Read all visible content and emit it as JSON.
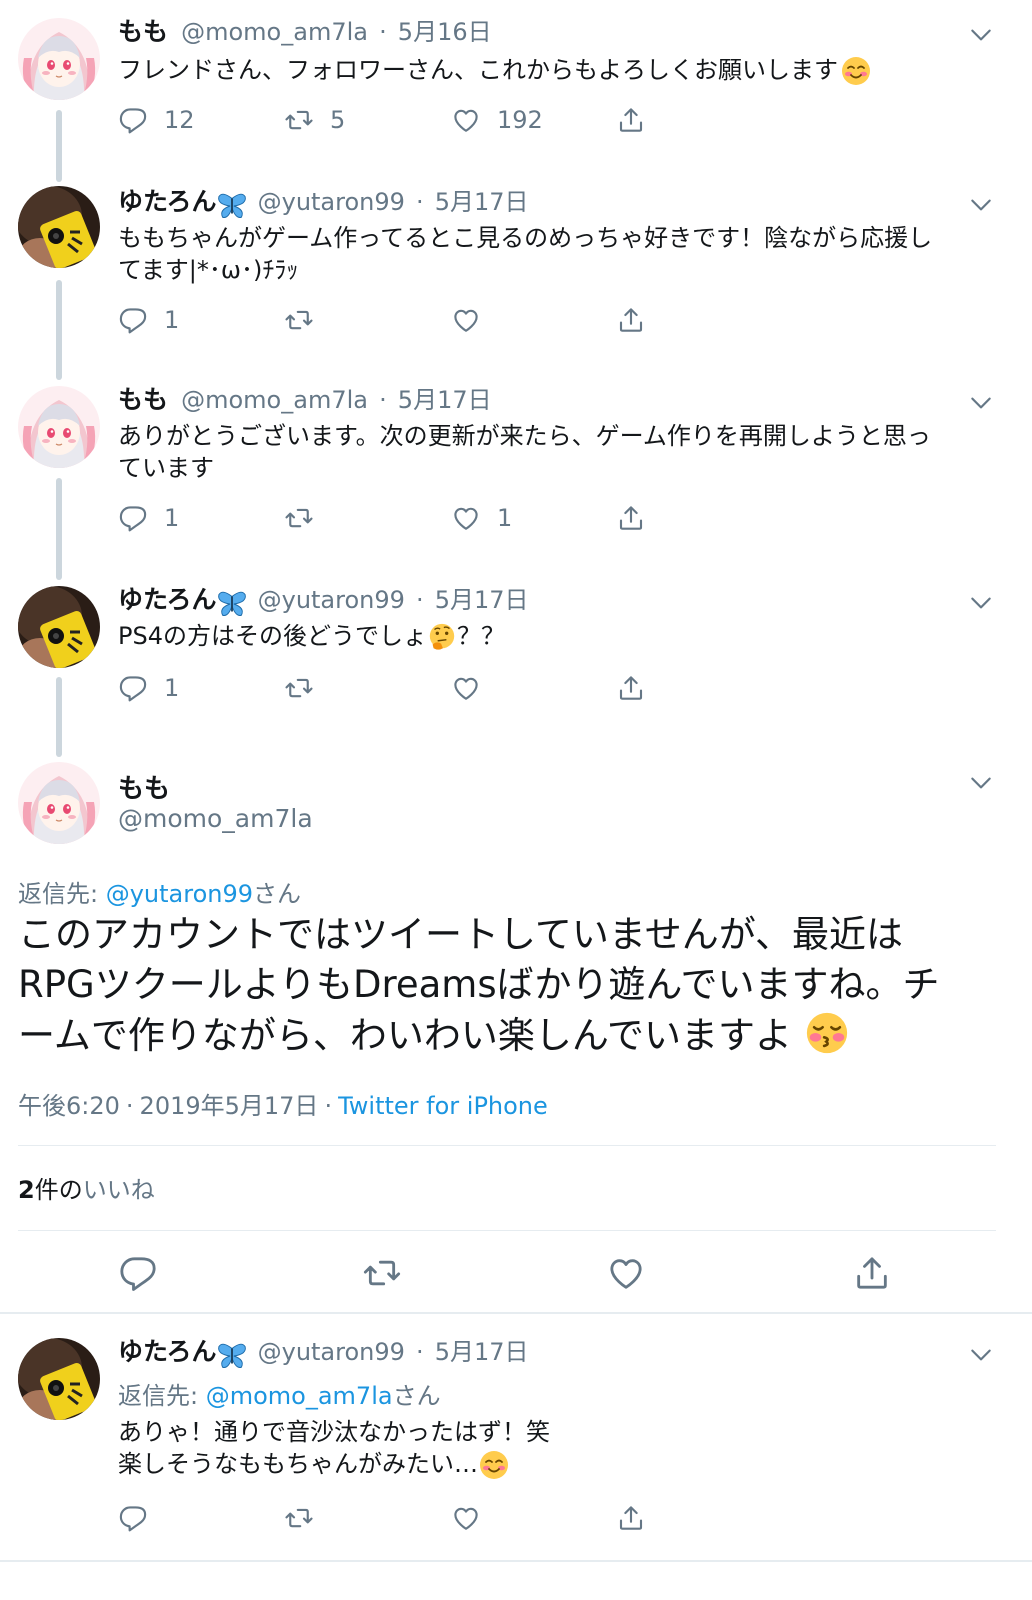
{
  "tweets": [
    {
      "name": "もも",
      "handle": "@momo_am7la",
      "date": "5月16日",
      "text": "フレンドさん、フォロワーさん、これからもよろしくお願いします",
      "reply_count": "12",
      "retweet_count": "5",
      "like_count": "192"
    },
    {
      "name": "ゆたろん",
      "handle": "@yutaron99",
      "date": "5月17日",
      "text_line1": "ももちゃんがゲーム作ってるとこ見るのめっちゃ好きです！陰ながら応援し",
      "text_line2": "てます|*･ω･)ﾁﾗｯ",
      "reply_count": "1",
      "retweet_count": "",
      "like_count": ""
    },
    {
      "name": "もも",
      "handle": "@momo_am7la",
      "date": "5月17日",
      "text_line1": "ありがとうございます。次の更新が来たら、ゲーム作りを再開しようと思っ",
      "text_line2": "ています",
      "reply_count": "1",
      "retweet_count": "",
      "like_count": "1"
    },
    {
      "name": "ゆたろん",
      "handle": "@yutaron99",
      "date": "5月17日",
      "text_before": "PS4の方はその後どうでしょ",
      "text_after": "？？",
      "reply_count": "1",
      "retweet_count": "",
      "like_count": ""
    }
  ],
  "focused": {
    "name": "もも",
    "handle": "@momo_am7la",
    "reply_prefix": "返信先: ",
    "reply_to": "@yutaron99",
    "reply_suffix": "さん",
    "text_line1": "このアカウントではツイートしていませんが、最近は",
    "text_line2": "RPGツクールよりもDreamsばかり遊んでいますね。チ",
    "text_line3": "ームで作りながら、わいわい楽しんでいますよ",
    "time": "午後6:20",
    "date": "2019年5月17日",
    "source": "Twitter for iPhone",
    "likes_count": "2",
    "likes_label": "件の",
    "likes_link": "いいね"
  },
  "reply": {
    "name": "ゆたろん",
    "handle": "@yutaron99",
    "date": "5月17日",
    "reply_prefix": "返信先: ",
    "reply_to": "@momo_am7la",
    "reply_suffix": "さん",
    "text_line1": "ありゃ！通りで音沙汰なかったはず！笑",
    "text_line2": "楽しそうなももちゃんがみたい…",
    "reply_count": "",
    "retweet_count": "",
    "like_count": ""
  },
  "colors": {
    "accent": "#1b95e0",
    "muted": "#657786",
    "text": "#14171a",
    "thread_line": "#ccd6dd"
  },
  "icons": [
    "reply-icon",
    "retweet-icon",
    "like-icon",
    "share-icon",
    "chevron-down-icon",
    "butterfly-emoji",
    "smiling-emoji",
    "thinking-emoji",
    "kissing-emoji"
  ]
}
